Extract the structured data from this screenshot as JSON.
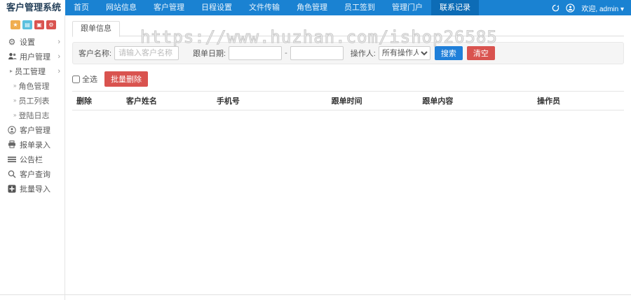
{
  "app": {
    "title": "客户管理系统",
    "welcome": "欢迎, admin",
    "caret": "▾"
  },
  "navbar": {
    "items": [
      {
        "label": "首页"
      },
      {
        "label": "网站信息"
      },
      {
        "label": "客户管理"
      },
      {
        "label": "日程设置"
      },
      {
        "label": "文件传输"
      },
      {
        "label": "角色管理"
      },
      {
        "label": "员工签到"
      },
      {
        "label": "管理门户"
      },
      {
        "label": "联系记录"
      }
    ]
  },
  "sidebar": {
    "quick_buttons": [
      {
        "name": "star",
        "glyph": "★",
        "color": "#f0ad4e"
      },
      {
        "name": "file",
        "glyph": "▤",
        "color": "#5bc0de"
      },
      {
        "name": "box",
        "glyph": "▣",
        "color": "#d9534f"
      },
      {
        "name": "gear",
        "glyph": "⚙",
        "color": "#d9534f"
      }
    ],
    "items": {
      "settings": {
        "label": "设置",
        "chevron": "›"
      },
      "user_mgmt": {
        "label": "用户管理",
        "chevron": "›"
      },
      "employee_mgmt": {
        "label": "员工管理",
        "chevron": "›",
        "bullet": "▸"
      },
      "role_mgmt": {
        "label": "角色管理",
        "bullet": "»"
      },
      "employee_list": {
        "label": "员工列表",
        "bullet": "»"
      },
      "login_log": {
        "label": "登陆日志",
        "bullet": "»"
      },
      "customer_mgmt": {
        "label": "客户管理"
      },
      "order_entry": {
        "label": "报单录入"
      },
      "bulletin": {
        "label": "公告栏"
      },
      "customer_query": {
        "label": "客户查询"
      },
      "batch_import": {
        "label": "批量导入"
      }
    }
  },
  "content": {
    "tab_label": "跟单信息",
    "filter": {
      "customer_label": "客户名称:",
      "customer_placeholder": "请输入客户名称",
      "date_label": "跟单日期:",
      "date_separator": "-",
      "operator_label": "操作人:",
      "operator_selected": "所有操作人",
      "search_label": "搜索",
      "clear_label": "清空"
    },
    "toolbar": {
      "select_all_label": "全选",
      "batch_delete_label": "批量删除"
    },
    "table": {
      "headers": [
        "删除",
        "客户姓名",
        "手机号",
        "跟单时间",
        "跟单内容",
        "操作员"
      ],
      "rows": []
    }
  },
  "watermark": "https://www.huzhan.com/ishop26585",
  "colors": {
    "navbar": "#1a82d2",
    "navbar_active": "#0d6cb6",
    "primary_button": "#1f7fd9",
    "danger_button": "#d9534f"
  }
}
